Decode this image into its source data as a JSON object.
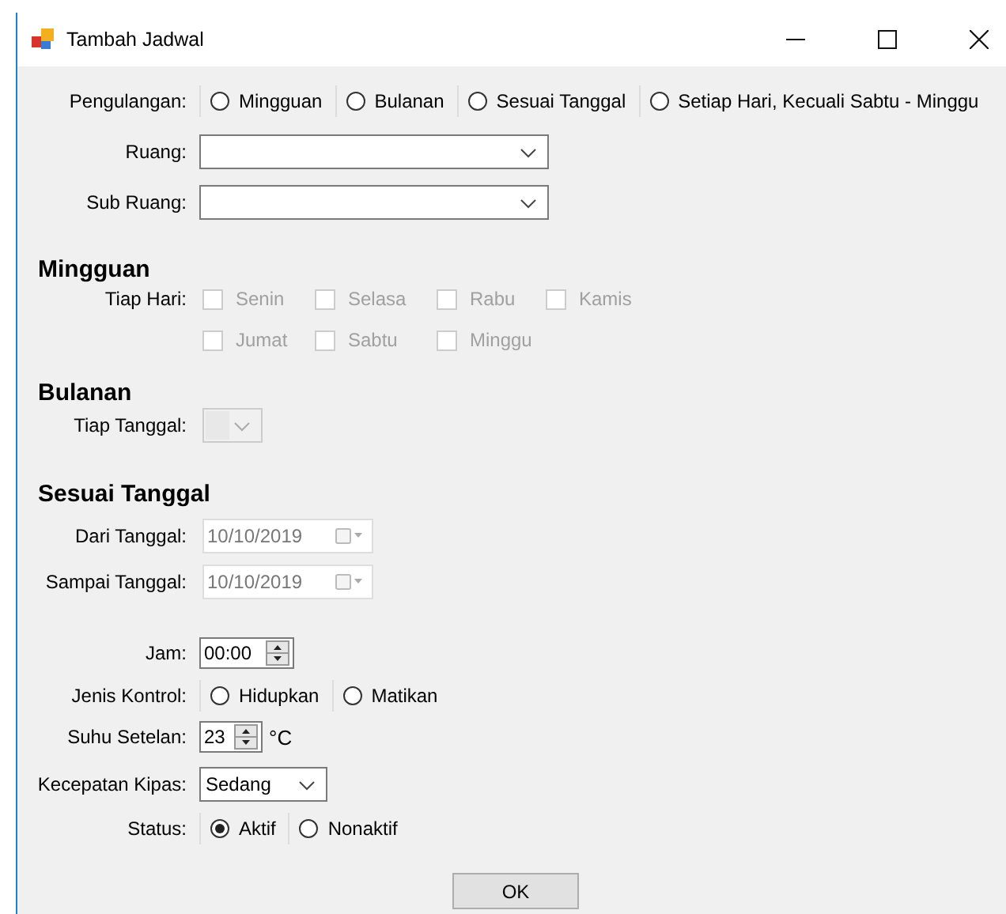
{
  "window": {
    "title": "Tambah Jadwal"
  },
  "pengulangan": {
    "label": "Pengulangan:",
    "options": [
      {
        "label": "Mingguan",
        "selected": false
      },
      {
        "label": "Bulanan",
        "selected": false
      },
      {
        "label": "Sesuai Tanggal",
        "selected": false
      },
      {
        "label": "Setiap Hari, Kecuali Sabtu - Minggu",
        "selected": false
      }
    ]
  },
  "ruang": {
    "label": "Ruang:"
  },
  "sub_ruang": {
    "label": "Sub Ruang:"
  },
  "mingguan": {
    "heading": "Mingguan",
    "label": "Tiap Hari:",
    "disabled": true,
    "days": [
      {
        "label": "Senin",
        "checked": false
      },
      {
        "label": "Selasa",
        "checked": false
      },
      {
        "label": "Rabu",
        "checked": false
      },
      {
        "label": "Kamis",
        "checked": false
      },
      {
        "label": "Jumat",
        "checked": false
      },
      {
        "label": "Sabtu",
        "checked": false
      },
      {
        "label": "Minggu",
        "checked": false
      }
    ]
  },
  "bulanan": {
    "heading": "Bulanan",
    "label": "Tiap Tanggal:",
    "disabled": true
  },
  "sesuai_tanggal": {
    "heading": "Sesuai Tanggal",
    "disabled": true,
    "fields": [
      {
        "label": "Dari Tanggal:",
        "value": "10/10/2019"
      },
      {
        "label": "Sampai Tanggal:",
        "value": "10/10/2019"
      }
    ]
  },
  "jam": {
    "label": "Jam:",
    "value": "00:00"
  },
  "jenis_kontrol": {
    "label": "Jenis Kontrol:",
    "options": [
      {
        "label": "Hidupkan",
        "selected": false
      },
      {
        "label": "Matikan",
        "selected": false
      }
    ]
  },
  "suhu": {
    "label": "Suhu Setelan:",
    "value": "23",
    "unit": "°C"
  },
  "kecepatan": {
    "label": "Kecepatan Kipas:",
    "value": "Sedang"
  },
  "status": {
    "label": "Status:",
    "options": [
      {
        "label": "Aktif",
        "selected": true
      },
      {
        "label": "Nonaktif",
        "selected": false
      }
    ]
  },
  "ok_button": "OK"
}
